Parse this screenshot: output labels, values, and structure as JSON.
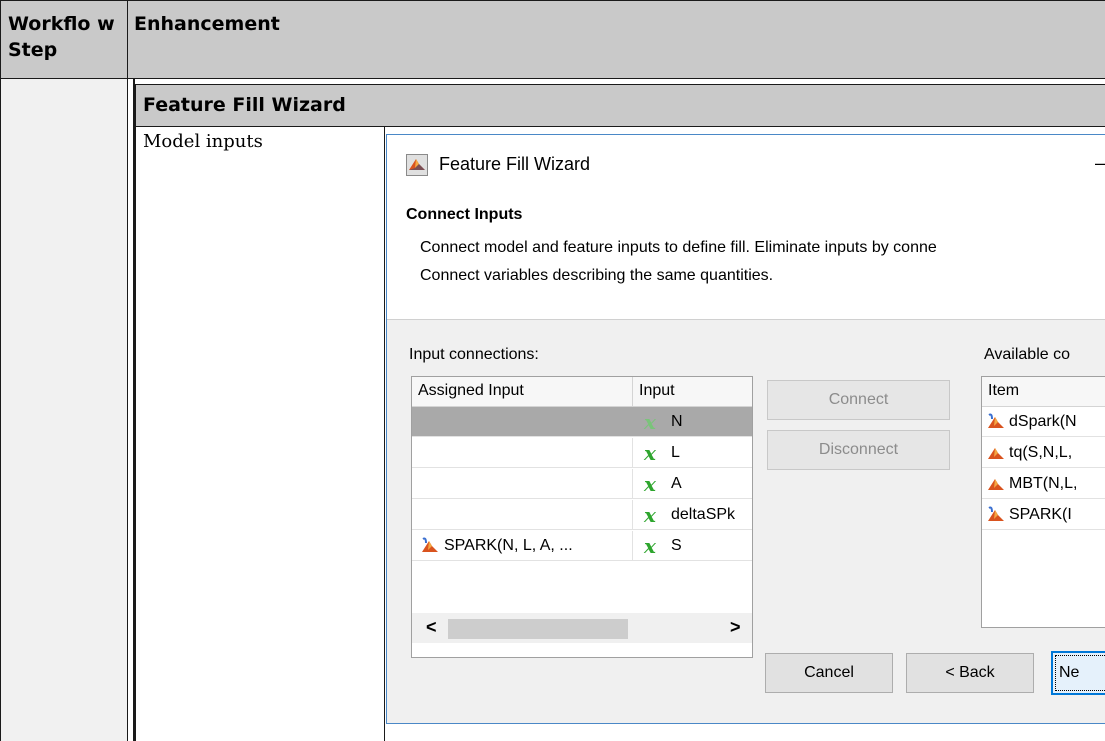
{
  "table": {
    "headers": {
      "workflow_step": "Workflo w Step",
      "enhancement": "Enhancement"
    },
    "section_title": "Feature Fill Wizard",
    "row_label": "Model inputs"
  },
  "dialog": {
    "title": "Feature Fill Wizard",
    "minimize_glyph": "–",
    "section_title": "Connect Inputs",
    "description_line1": "Connect model and feature inputs to define fill. Eliminate inputs by conne",
    "description_line2": "Connect variables describing the same quantities.",
    "input_connections_label": "Input connections:",
    "available_label": "Available co",
    "connections_grid": {
      "columns": [
        "Assigned Input",
        "Input"
      ],
      "rows": [
        {
          "assigned": "",
          "input": "N",
          "selected": true
        },
        {
          "assigned": "",
          "input": "L",
          "selected": false
        },
        {
          "assigned": "",
          "input": "A",
          "selected": false
        },
        {
          "assigned": "",
          "input": "deltaSPk",
          "selected": false
        },
        {
          "assigned": "SPARK(N, L, A, ...",
          "input": "S",
          "selected": false
        }
      ]
    },
    "scroll_left": "<",
    "scroll_right": ">",
    "connect_button": "Connect",
    "disconnect_button": "Disconnect",
    "available_grid": {
      "column": "Item",
      "items": [
        "dSpark(N",
        "tq(S,N,L,",
        "MBT(N,L,",
        "SPARK(I"
      ]
    },
    "cancel_button": "Cancel",
    "back_button": "< Back",
    "next_button": "Ne"
  },
  "colors": {
    "header_bg": "#c9c9c9",
    "dialog_border": "#4a88c7",
    "selected_row": "#a9a9a9",
    "x_symbol": "#2ea52e"
  },
  "icons": {
    "dialog_icon": "matlab-icon",
    "model_icon": "matlab-model-icon",
    "variable_icon": "x-variable-icon"
  }
}
